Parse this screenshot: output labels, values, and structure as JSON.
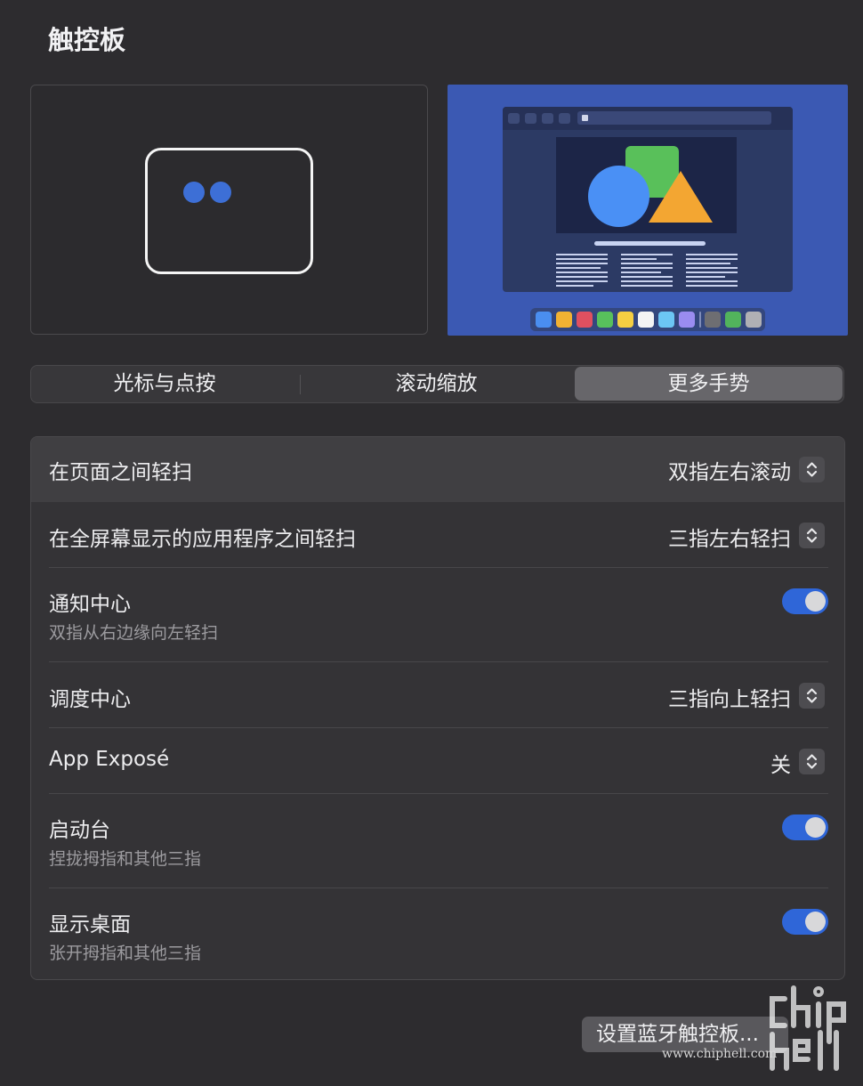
{
  "window": {
    "title": "触控板"
  },
  "segments": [
    {
      "label": "光标与点按",
      "active": false
    },
    {
      "label": "滚动缩放",
      "active": false
    },
    {
      "label": "更多手势",
      "active": true
    }
  ],
  "settings": [
    {
      "label": "在页面之间轻扫",
      "control": "popup",
      "value": "双指左右滚动",
      "highlighted": true
    },
    {
      "label": "在全屏幕显示的应用程序之间轻扫",
      "control": "popup",
      "value": "三指左右轻扫"
    },
    {
      "label": "通知中心",
      "sublabel": "双指从右边缘向左轻扫",
      "control": "toggle",
      "on": true
    },
    {
      "label": "调度中心",
      "control": "popup",
      "value": "三指向上轻扫"
    },
    {
      "label": "App Exposé",
      "control": "popup",
      "value": "关"
    },
    {
      "label": "启动台",
      "sublabel": "捏拢拇指和其他三指",
      "control": "toggle",
      "on": true
    },
    {
      "label": "显示桌面",
      "sublabel": "张开拇指和其他三指",
      "control": "toggle",
      "on": true
    }
  ],
  "footer": {
    "bluetooth_button": "设置蓝牙触控板..."
  },
  "watermark": {
    "url": "www.chiphell.com",
    "logo": "chip hell"
  },
  "colors": {
    "accent": "#2f66d8",
    "background": "#2d2c2f",
    "finger": "#3d6fd6"
  },
  "icons": {
    "stepper": "chevron-up-down-icon"
  }
}
